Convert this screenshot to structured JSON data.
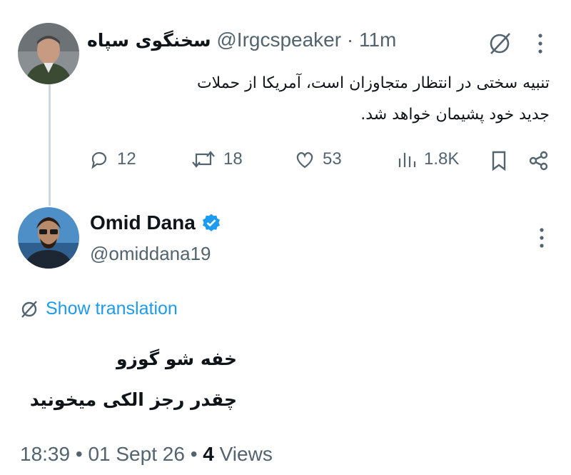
{
  "parent_tweet": {
    "display_name": "سخنگوی سپاه",
    "handle": "@Irgcspeaker",
    "separator": "·",
    "time": "11m",
    "text_line1": "تنبیه سختی در انتظار متجاوزان است، آمریکا از حملات",
    "text_line2": "جدید خود پشیمان خواهد شد.",
    "replies": "12",
    "retweets": "18",
    "likes": "53",
    "views": "1.8K",
    "icons": [
      "translate-off-icon",
      "more-icon",
      "reply-icon",
      "retweet-icon",
      "like-icon",
      "views-icon",
      "bookmark-icon",
      "share-icon"
    ]
  },
  "reply_tweet": {
    "display_name": "Omid Dana",
    "handle": "@omiddana19",
    "verified": true,
    "show_translation": "Show translation",
    "line1": "خفه شو گوزو",
    "line2": "چقدر رجز الکی میخونید",
    "time": "18:39",
    "date": "01 Sept 26",
    "dot": "•",
    "views_count": "4",
    "views_label": "Views"
  },
  "colors": {
    "accent": "#1d9bf0",
    "muted": "#536471",
    "text": "#0f1419",
    "thread_line": "#cfd9de"
  }
}
